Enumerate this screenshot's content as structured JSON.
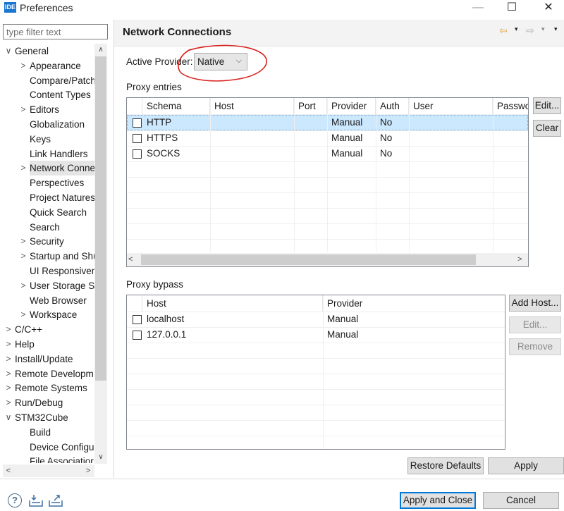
{
  "window": {
    "app_icon": "IDE",
    "title": "Preferences",
    "minimize": "—",
    "maximize": "☐",
    "close": "✕"
  },
  "filter": {
    "placeholder": "type filter text"
  },
  "tree": {
    "items": [
      {
        "label": "General",
        "arrow": "∨",
        "level": 0
      },
      {
        "label": "Appearance",
        "arrow": ">",
        "level": 1
      },
      {
        "label": "Compare/Patch",
        "arrow": "",
        "level": 1
      },
      {
        "label": "Content Types",
        "arrow": "",
        "level": 1
      },
      {
        "label": "Editors",
        "arrow": ">",
        "level": 1
      },
      {
        "label": "Globalization",
        "arrow": "",
        "level": 1
      },
      {
        "label": "Keys",
        "arrow": "",
        "level": 1
      },
      {
        "label": "Link Handlers",
        "arrow": "",
        "level": 1
      },
      {
        "label": "Network Conne",
        "arrow": ">",
        "level": 1,
        "selected": true
      },
      {
        "label": "Perspectives",
        "arrow": "",
        "level": 1
      },
      {
        "label": "Project Natures",
        "arrow": "",
        "level": 1
      },
      {
        "label": "Quick Search",
        "arrow": "",
        "level": 1
      },
      {
        "label": "Search",
        "arrow": "",
        "level": 1
      },
      {
        "label": "Security",
        "arrow": ">",
        "level": 1
      },
      {
        "label": "Startup and Shu",
        "arrow": ">",
        "level": 1
      },
      {
        "label": "UI Responsiven",
        "arrow": "",
        "level": 1
      },
      {
        "label": "User Storage Se",
        "arrow": ">",
        "level": 1
      },
      {
        "label": "Web Browser",
        "arrow": "",
        "level": 1
      },
      {
        "label": "Workspace",
        "arrow": ">",
        "level": 1
      },
      {
        "label": "C/C++",
        "arrow": ">",
        "level": 0
      },
      {
        "label": "Help",
        "arrow": ">",
        "level": 0
      },
      {
        "label": "Install/Update",
        "arrow": ">",
        "level": 0
      },
      {
        "label": "Remote Developm",
        "arrow": ">",
        "level": 0
      },
      {
        "label": "Remote Systems",
        "arrow": ">",
        "level": 0
      },
      {
        "label": "Run/Debug",
        "arrow": ">",
        "level": 0
      },
      {
        "label": "STM32Cube",
        "arrow": "∨",
        "level": 0
      },
      {
        "label": "Build",
        "arrow": "",
        "level": 1
      },
      {
        "label": "Device Configu",
        "arrow": "",
        "level": 1
      },
      {
        "label": "File Associatior",
        "arrow": "",
        "level": 1
      }
    ],
    "scroll_up": "∧",
    "scroll_down": "∨",
    "scroll_left": "<",
    "scroll_right": ">"
  },
  "page": {
    "title": "Network Connections",
    "nav_back": "⇦",
    "nav_menu": "▾",
    "nav_forward": "⇨",
    "view_menu": "▾"
  },
  "active_provider": {
    "label": "Active Provider:",
    "value": "Native",
    "chevron": "⌵"
  },
  "proxy_entries": {
    "label": "Proxy entries",
    "columns": [
      "Schema",
      "Host",
      "Port",
      "Provider",
      "Auth",
      "User",
      "Passwo"
    ],
    "rows": [
      {
        "schema": "HTTP",
        "host": "",
        "port": "",
        "provider": "Manual",
        "auth": "No",
        "user": "",
        "password": ""
      },
      {
        "schema": "HTTPS",
        "host": "",
        "port": "",
        "provider": "Manual",
        "auth": "No",
        "user": "",
        "password": ""
      },
      {
        "schema": "SOCKS",
        "host": "",
        "port": "",
        "provider": "Manual",
        "auth": "No",
        "user": "",
        "password": ""
      }
    ],
    "scroll_left": "<",
    "scroll_right": ">",
    "edit_button": "Edit...",
    "clear_button": "Clear"
  },
  "proxy_bypass": {
    "label": "Proxy bypass",
    "columns": [
      "Host",
      "Provider"
    ],
    "rows": [
      {
        "host": "localhost",
        "provider": "Manual"
      },
      {
        "host": "127.0.0.1",
        "provider": "Manual"
      }
    ],
    "add_host_button": "Add Host...",
    "edit_button": "Edit...",
    "remove_button": "Remove"
  },
  "buttons": {
    "restore_defaults": "Restore Defaults",
    "apply": "Apply",
    "apply_and_close": "Apply and Close",
    "cancel": "Cancel"
  },
  "footer": {
    "help_icon": "?"
  },
  "colors": {
    "selection": "#cce8ff",
    "accent": "#0078d7",
    "annotation": "#d9231f"
  }
}
